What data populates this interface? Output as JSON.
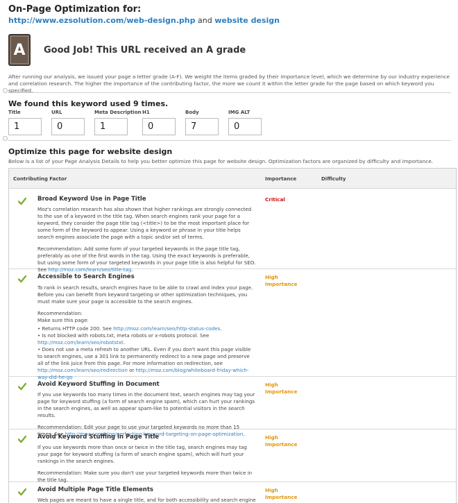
{
  "header": {
    "title": "On-Page Optimization for:",
    "url": "http://www.ezsolution.com/web-design.php",
    "and": "and",
    "keyword": "website design"
  },
  "grade": {
    "letter": "A",
    "message": "Good Job! This URL received an A grade",
    "intro": "After running our analysis, we issued your page a letter grade (A-F). We weight the items graded by their importance level, which we determine by our industry experience and correlation research. The higher the importance of the contributing factor, the more we count it within the letter grade for the page based on which keyword you specified."
  },
  "found": {
    "title": "We found this keyword used 9 times.",
    "metrics": [
      {
        "label": "Title",
        "value": "1"
      },
      {
        "label": "URL",
        "value": "0"
      },
      {
        "label": "Meta Description",
        "value": "1"
      },
      {
        "label": "H1",
        "value": "0"
      },
      {
        "label": "Body",
        "value": "7"
      },
      {
        "label": "IMG ALT",
        "value": "0"
      }
    ]
  },
  "optimize": {
    "title": "Optimize this page for website design",
    "subtitle": "Below is a list of your Page Analysis Details to help you better optimize this page for website design. Optimization factors are organized by difficulty and importance."
  },
  "table": {
    "headers": {
      "factor": "Contributing Factor",
      "importance": "Importance",
      "difficulty": "Difficulty"
    },
    "rows": [
      {
        "title": "Broad Keyword Use in Page Title",
        "importance": "Critical",
        "p1": "Moz's correlation research has also shown that higher rankings are strongly connected to the use of a keyword in the title tag. When search engines rank your page for a keyword, they consider the page title tag (<title>) to be the most important place for some form of the keyword to appear. Using a keyword or phrase in your title helps search engines associate the page with a topic and/or set of terms.",
        "p2": "Recommendation: Add some form of your targeted keywords in the page title tag, preferably as one of the first words in the tag. Using the exact keywords is preferable, but using some form of your targeted keywords in your page title is also helpful for SEO. See",
        "link": "http://moz.com/learn/seo/title-tag",
        "tail": "."
      },
      {
        "title": "Accessible to Search Engines",
        "importance_1": "High",
        "importance_2": "Importance",
        "p1": "To rank in search results, search engines have to be able to crawl and index your page. Before you can benefit from keyword targeting or other optimization techniques, you must make sure your page is accessible to the search engines.",
        "rec": "Recommendation:",
        "make_sure": "Make sure this page:",
        "b1": "Returns HTTP code 200. See",
        "b1_link": "http://moz.com/learn/seo/http-status-codes",
        "b2": "Is not blocked with robots.txt, meta robots or x-robots protocol. See",
        "b2_link": "http://moz.com/learn/seo/robotstxt",
        "b3": "Does not use a meta refresh to another URL. Even if you don't want this page visible to search engines, use a 301 link to permanently redirect to a new page and preserve all of the link juice from this page. For more information on redirection, see",
        "b3_link1": "http://moz.com/learn/seo/redirection",
        "b3_or": "or",
        "b3_link2": "http://moz.com/blog/whiteboard-friday-which-way-did-he-go",
        "dot": "."
      },
      {
        "title": "Avoid Keyword Stuffing in Document",
        "importance_1": "High",
        "importance_2": "Importance",
        "p1": "If you use keywords too many times in the document text, search engines may tag your page for keyword stuffing (a form of search engine spam), which can hurt your rankings in the search engines, as well as appear spam-like to potential visitors in the search results.",
        "p2": "Recommendation: Edit your page to use your targeted keywords no more than 15 times. See",
        "link": "http://moz.com/blog/perfecting-keyword-targeting-on-page-optimization",
        "tail": "."
      },
      {
        "title": "Avoid Keyword Stuffing in Page Title",
        "importance_1": "High",
        "importance_2": "Importance",
        "p1": "If you use keywords more than once or twice in the title tag, search engines may tag your page for keyword stuffing (a form of search engine spam), which will hurt your rankings in the search engines.",
        "p2": "Recommendation: Make sure you don't use your targeted keywords more than twice in the title tag."
      },
      {
        "title": "Avoid Multiple Page Title Elements",
        "importance_1": "High",
        "importance_2": "Importance",
        "p1": "Web pages are meant to have a single title, and for both accessibility and search engine optimization reasons, we strongly recommend following this practice."
      }
    ]
  },
  "colors": {
    "link": "#2b7fc1",
    "critical": "#cc1111",
    "high": "#e0960a",
    "check": "#7fae2b"
  }
}
